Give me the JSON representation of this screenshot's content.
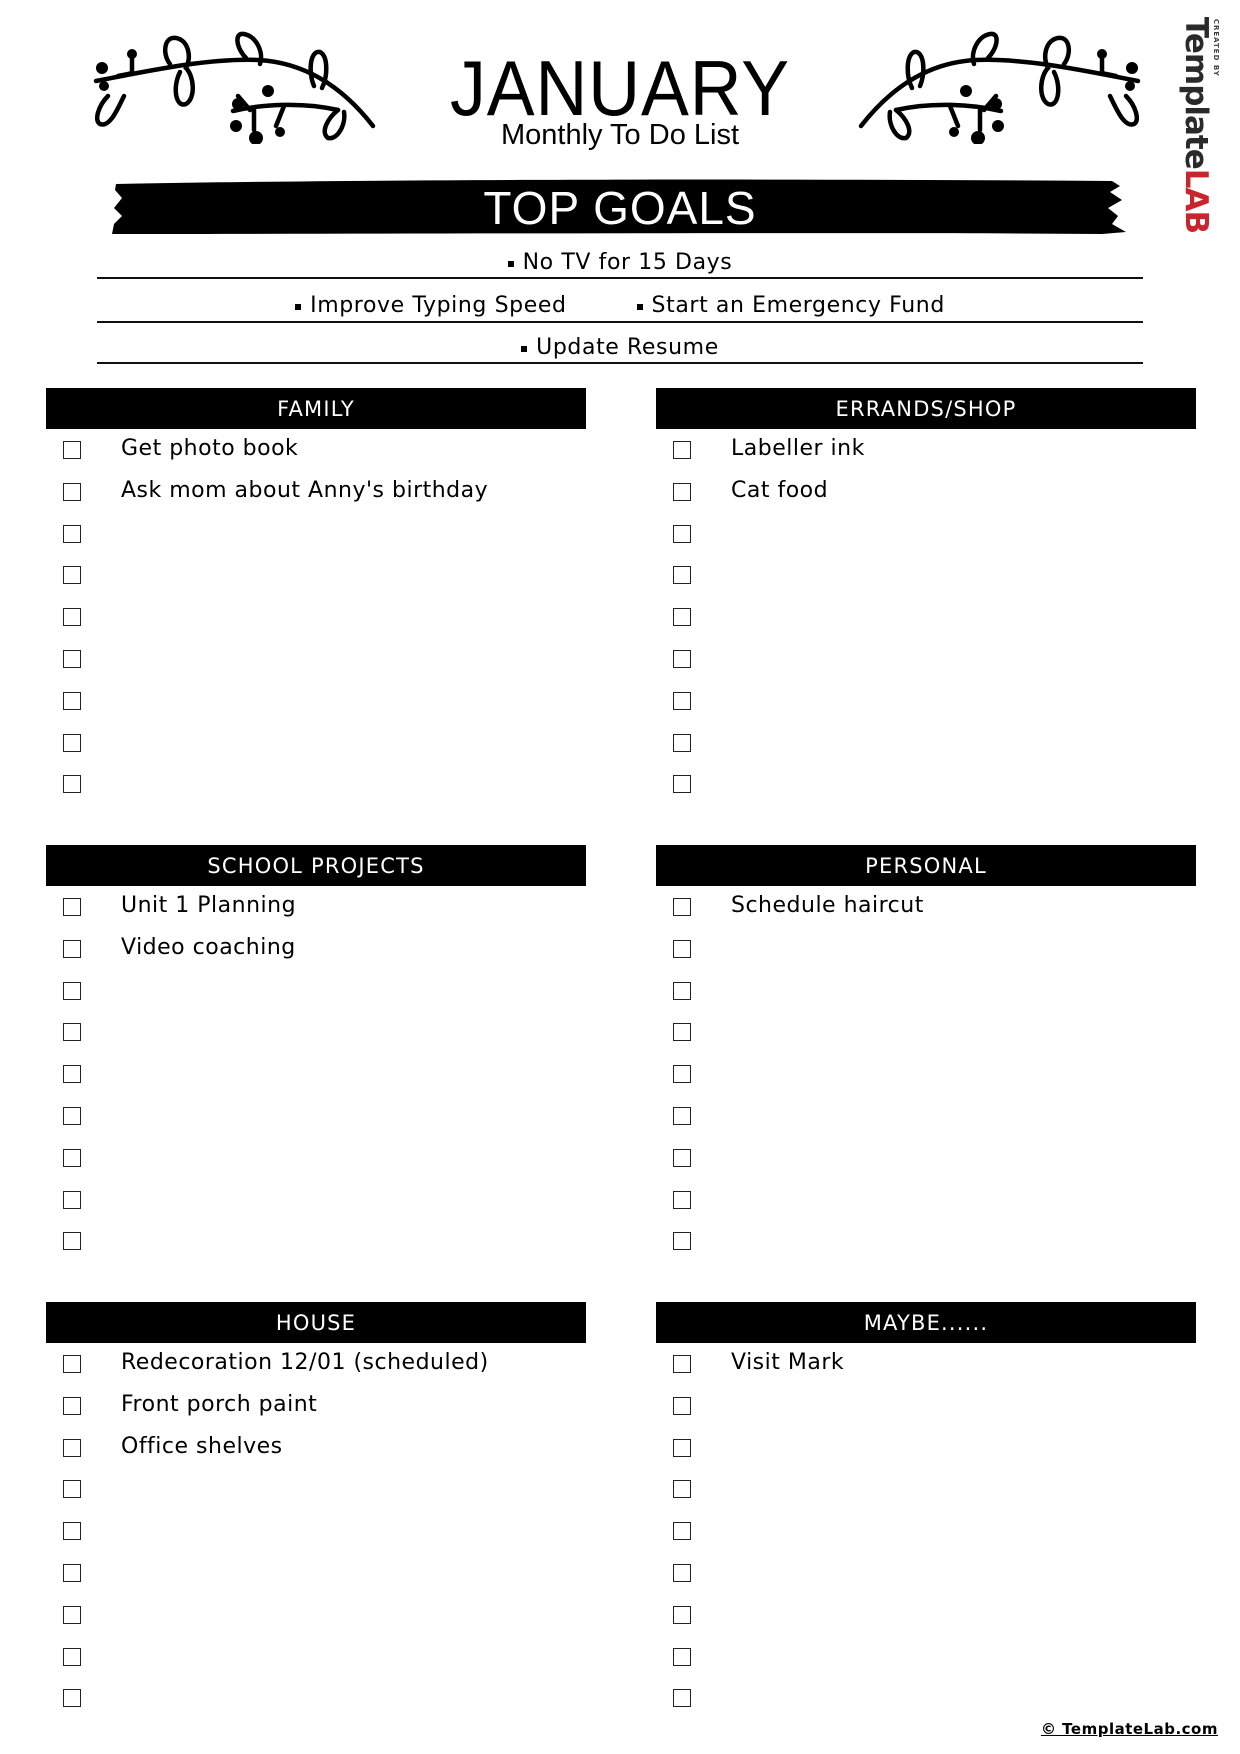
{
  "header": {
    "title": "JANUARY",
    "subtitle": "Monthly To Do List"
  },
  "brand": {
    "created_by": "CREATED BY",
    "template": "Template",
    "lab": "LAB",
    "lab_color": "#c8262c"
  },
  "top_goals": {
    "title": "TOP GOALS",
    "rows": [
      [
        "No TV for 15 Days"
      ],
      [
        "Improve Typing Speed",
        "Start an Emergency Fund"
      ],
      [
        "Update Resume"
      ]
    ]
  },
  "sections": [
    {
      "title": "FAMILY",
      "items": [
        "Get photo book",
        "Ask mom about Anny's birthday",
        "",
        "",
        "",
        "",
        "",
        "",
        ""
      ]
    },
    {
      "title": "ERRANDS/SHOP",
      "items": [
        "Labeller ink",
        "Cat food",
        "",
        "",
        "",
        "",
        "",
        "",
        ""
      ]
    },
    {
      "title": "SCHOOL PROJECTS",
      "items": [
        "Unit 1 Planning",
        "Video coaching",
        "",
        "",
        "",
        "",
        "",
        "",
        ""
      ]
    },
    {
      "title": "PERSONAL",
      "items": [
        "Schedule haircut",
        "",
        "",
        "",
        "",
        "",
        "",
        "",
        ""
      ]
    },
    {
      "title": "HOUSE",
      "items": [
        "Redecoration 12/01 (scheduled)",
        "Front porch paint",
        "Office shelves",
        "",
        "",
        "",
        "",
        "",
        ""
      ]
    },
    {
      "title": "MAYBE......",
      "items": [
        "Visit Mark",
        "",
        "",
        "",
        "",
        "",
        "",
        "",
        ""
      ]
    }
  ],
  "footer": {
    "copyright": "© TemplateLab.com"
  }
}
